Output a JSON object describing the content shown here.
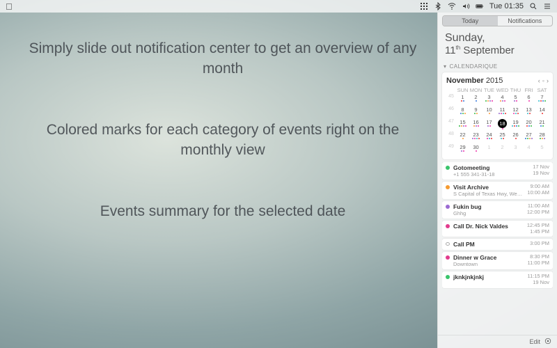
{
  "menubar": {
    "time": "Tue 01:35"
  },
  "promo": {
    "p1": "Simply slide out notification center to get an overview of any month",
    "p2": "Colored marks for each category of events right on the monthly view",
    "p3": "Events summary for the selected date"
  },
  "nc": {
    "tabs": {
      "today": "Today",
      "notifications": "Notifications",
      "active": "today"
    },
    "header": {
      "dow": "Sunday,",
      "date_pre": "11",
      "date_suf": "th",
      "date_post": " September"
    },
    "widget_name": "CALENDARIQUE",
    "calendar": {
      "month": "November",
      "year": "2015",
      "daynames": [
        "SUN",
        "MON",
        "TUE",
        "WED",
        "THU",
        "FRI",
        "SAT"
      ],
      "weeks": [
        {
          "wk": "45",
          "days": [
            {
              "n": "1"
            },
            {
              "n": "2"
            },
            {
              "n": "3"
            },
            {
              "n": "4"
            },
            {
              "n": "5"
            },
            {
              "n": "6"
            },
            {
              "n": "7"
            }
          ]
        },
        {
          "wk": "46",
          "days": [
            {
              "n": "8"
            },
            {
              "n": "9"
            },
            {
              "n": "10"
            },
            {
              "n": "11"
            },
            {
              "n": "12"
            },
            {
              "n": "13"
            },
            {
              "n": "14"
            }
          ]
        },
        {
          "wk": "47",
          "days": [
            {
              "n": "15"
            },
            {
              "n": "16"
            },
            {
              "n": "17"
            },
            {
              "n": "18",
              "today": true
            },
            {
              "n": "19"
            },
            {
              "n": "20"
            },
            {
              "n": "21"
            }
          ]
        },
        {
          "wk": "48",
          "days": [
            {
              "n": "22"
            },
            {
              "n": "23"
            },
            {
              "n": "24"
            },
            {
              "n": "25"
            },
            {
              "n": "26"
            },
            {
              "n": "27"
            },
            {
              "n": "28"
            }
          ]
        },
        {
          "wk": "49",
          "days": [
            {
              "n": "29"
            },
            {
              "n": "30"
            },
            {
              "n": "1",
              "out": true
            },
            {
              "n": "2",
              "out": true
            },
            {
              "n": "3",
              "out": true
            },
            {
              "n": "4",
              "out": true
            },
            {
              "n": "5",
              "out": true
            }
          ]
        }
      ]
    },
    "events": [
      {
        "color": "c-g",
        "title": "Gotomeeting",
        "sub": "+1 555 341-31-18",
        "t1": "17 Nov",
        "t2": "19 Nov"
      },
      {
        "color": "c-o",
        "title": "Visit Archive",
        "sub": "S Capital of Texas Hwy, West Lake Hill…",
        "t1": "9:00 AM",
        "t2": "10:00 AM"
      },
      {
        "color": "c-pu",
        "title": "Fukin bug",
        "sub": "Ghhg",
        "t1": "11:00 AM",
        "t2": "12:00 PM"
      },
      {
        "color": "c-pk",
        "title": "Call Dr. Nick Valdes",
        "sub": "",
        "t1": "12:45 PM",
        "t2": "1:45 PM"
      },
      {
        "outline": true,
        "title": "Call PM",
        "sub": "",
        "t1": "3:00 PM",
        "t2": ""
      },
      {
        "color": "c-pk",
        "title": "Dinner w Grace",
        "sub": "Downtown",
        "t1": "8:30 PM",
        "t2": "11:00 PM"
      },
      {
        "color": "c-g",
        "title": "jknkjnkjnkj",
        "sub": "",
        "t1": "11:15 PM",
        "t2": "19 Nov"
      }
    ],
    "edit_label": "Edit"
  }
}
